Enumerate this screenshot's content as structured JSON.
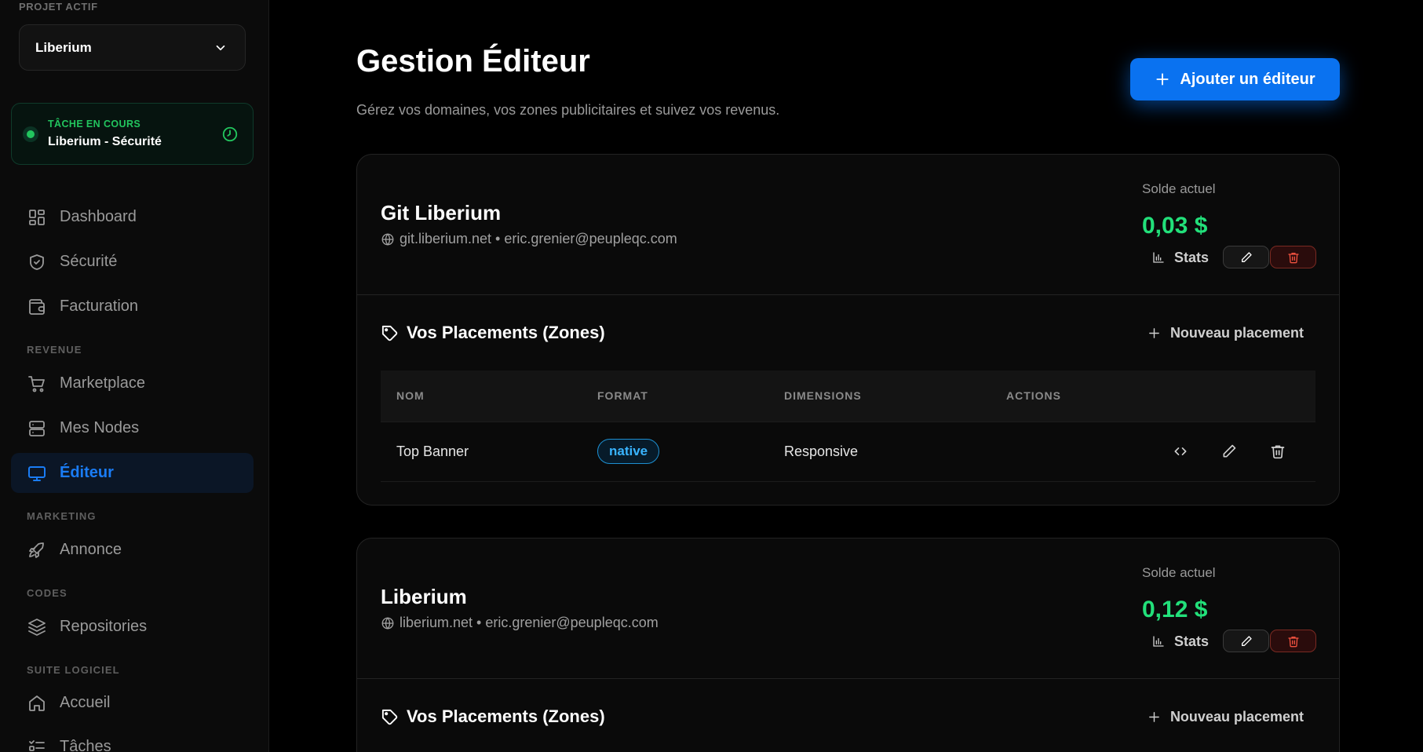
{
  "sidebar": {
    "project_label": "PROJET ACTIF",
    "project_name": "Liberium",
    "task": {
      "title": "TÂCHE EN COURS",
      "name": "Liberium - Sécurité"
    },
    "items": {
      "dashboard": "Dashboard",
      "securite": "Sécurité",
      "facturation": "Facturation",
      "marketplace": "Marketplace",
      "nodes": "Mes Nodes",
      "editeur": "Éditeur",
      "annonce": "Annonce",
      "repositories": "Repositories",
      "accueil": "Accueil",
      "taches": "Tâches"
    },
    "sections": {
      "revenue": "REVENUE",
      "marketing": "MARKETING",
      "codes": "CODES",
      "suite": "SUITE LOGICIEL"
    }
  },
  "header": {
    "title": "Gestion Éditeur",
    "subtitle": "Gérez vos domaines, vos zones publicitaires et suivez vos revenus.",
    "add_button": "Ajouter un éditeur"
  },
  "labels": {
    "balance": "Solde actuel",
    "stats": "Stats",
    "placements_title": "Vos Placements (Zones)",
    "new_placement": "Nouveau placement"
  },
  "table_headers": [
    "NOM",
    "FORMAT",
    "DIMENSIONS",
    "ACTIONS"
  ],
  "publishers": [
    {
      "name": "Git Liberium",
      "meta": "git.liberium.net • eric.grenier@peupleqc.com",
      "balance": "0,03 $",
      "placements": [
        {
          "name": "Top Banner",
          "format": "native",
          "dimensions": "Responsive"
        }
      ]
    },
    {
      "name": "Liberium",
      "meta": "liberium.net • eric.grenier@peupleqc.com",
      "balance": "0,12 $",
      "placements": []
    }
  ],
  "colors": {
    "accent": "#0a72f0",
    "success": "#22e07a",
    "danger": "#f0513f",
    "badge": "#39b4ff"
  },
  "icons": [
    "chevron-down-icon",
    "clock-icon",
    "dashboard-icon",
    "shield-icon",
    "wallet-icon",
    "cart-icon",
    "server-icon",
    "monitor-icon",
    "rocket-icon",
    "layers-icon",
    "home-icon",
    "list-check-icon",
    "plus-icon",
    "globe-icon",
    "chart-icon",
    "pencil-icon",
    "trash-icon",
    "tag-icon",
    "code-icon"
  ]
}
